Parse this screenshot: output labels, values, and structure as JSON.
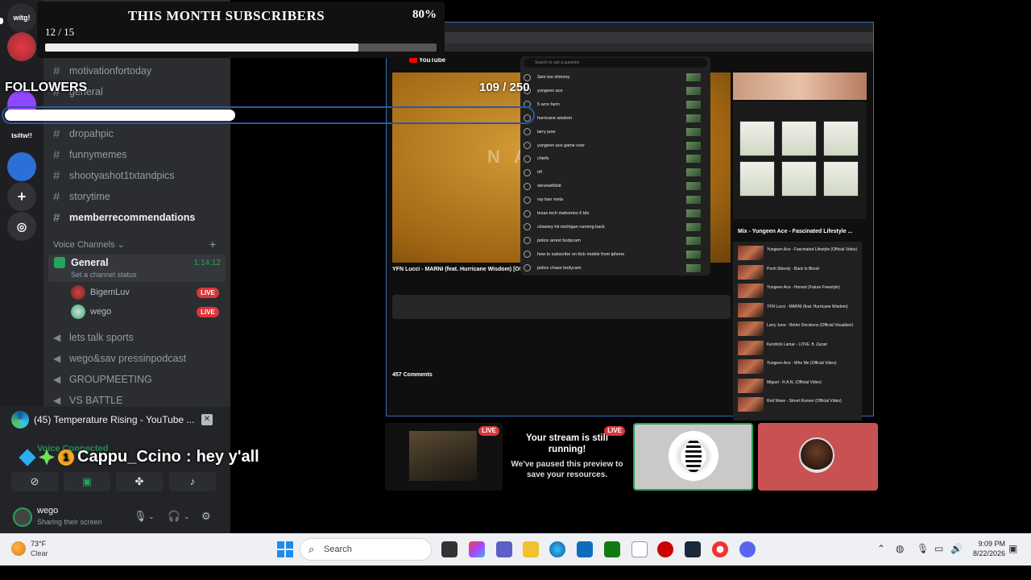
{
  "overlay": {
    "subscribers": {
      "title": "THIS MONTH SUBSCRIBERS",
      "percent_label": "80%",
      "count_label": "12 / 15",
      "progress": 0.8
    },
    "followers": {
      "label": "FOLLOWERS",
      "count_label": "109 / 250",
      "progress": 0.436
    },
    "chat": {
      "username": "Cappu_Ccino",
      "separator": ":",
      "message": "hey y'all"
    }
  },
  "rail": {
    "servers": [
      "witg!",
      "ts#tw!!"
    ]
  },
  "sidebar": {
    "text_channels": [
      {
        "name": "motivationfortoday",
        "bright": false
      },
      {
        "name": "general",
        "bright": false
      },
      {
        "name": "dropahpic",
        "bright": false
      },
      {
        "name": "funnymemes",
        "bright": false
      },
      {
        "name": "shootyashot1txtandpics",
        "bright": false
      },
      {
        "name": "storytime",
        "bright": false
      },
      {
        "name": "memberrecommendations",
        "bright": true
      }
    ],
    "voice_header": "Voice Channels",
    "voice_general": {
      "name": "General",
      "timer": "1:14:12",
      "status": "Set a channel status"
    },
    "voice_users": [
      {
        "name": "BigemLuv",
        "live": "LIVE"
      },
      {
        "name": "wego",
        "live": "LIVE"
      }
    ],
    "voice_channels": [
      "lets talk sports",
      "wego&sav pressinpodcast",
      "GROUPMEETING",
      "VS BATTLE"
    ]
  },
  "mini_player": {
    "title": "(45) Temperature Rising - YouTube ..."
  },
  "voice_connected": "Voice Connected",
  "user_panel": {
    "name": "wego",
    "status": "Sharing their screen"
  },
  "share": {
    "logo": "YouTube",
    "search_placeholder": "Search or ask a question",
    "video_title": "YFN Lucci - MARNI (feat. Hurricane Wisdom) [Off...",
    "comments": "457 Comments",
    "suggestions": [
      "3am toe shimmy",
      "yungeen ace",
      "5 acre farm",
      "hurricane wisdom",
      "larry june",
      "yungeen ace game over",
      "chiefs",
      "nfl",
      "stevewilldoit",
      "ray ban meta",
      "texas tech mahomes 6 tds",
      "clowney hit michigan running back",
      "police arrest bodycam",
      "how to subscribe on kick mobile from iphone",
      "police chase bodycam"
    ],
    "mix_title": "Mix - Yungeen Ace - Fascinated Lifestyle ...",
    "mix_items": [
      "Yungeen Ace - Fascinated Lifestyle (Official Video)",
      "Pooh Shiesty - Back In Blood",
      "Yungeen Ace - Honest (Future Freestyle)",
      "YFN Lucci - MARNI (feat. Hurricane Wisdom)",
      "Larry June - Better Decisions (Official Visualizer)",
      "Kendrick Lamar - LOVE. ft. Zacari",
      "Yungeen Ace - Who Me (Official Video)",
      "Miguel - R.A.N. (Official Video)",
      "Rod Wave - Street Runner (Official Video)"
    ]
  },
  "tiles": {
    "live": "LIVE",
    "paused_title": "Your stream is still running!",
    "paused_sub": "We've paused this preview to save your resources."
  },
  "taskbar": {
    "temp": "73°F",
    "condition": "Clear",
    "search": "Search",
    "time": "9:09 PM",
    "date": "8/22/2026"
  }
}
